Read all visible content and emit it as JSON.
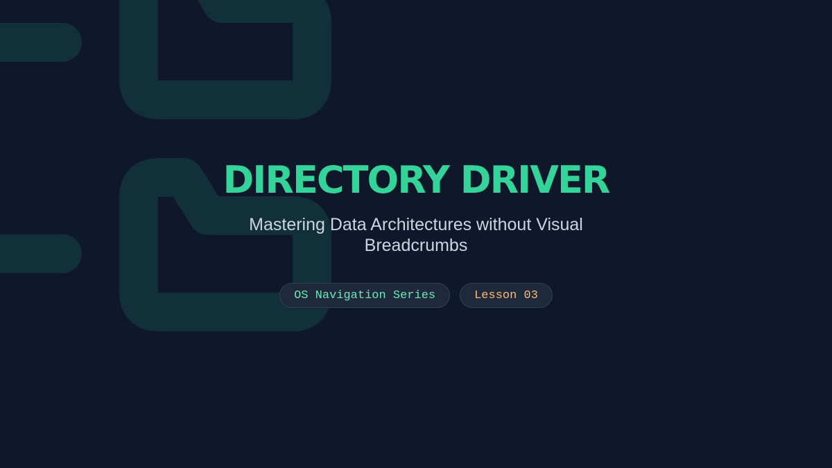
{
  "hero": {
    "title": "DIRECTORY DRIVER",
    "subtitle": "Mastering Data Architectures without Visual Breadcrumbs"
  },
  "tags": {
    "series": "OS Navigation Series",
    "lesson": "Lesson 03"
  },
  "background": {
    "icon": "folder-tree-icon"
  },
  "colors": {
    "background": "#0f172a",
    "accent": "#34d399",
    "subtitle_text": "#cbd5e1",
    "series_tag_text": "#6ee7b7",
    "lesson_tag_text": "#fdba74",
    "tag_background": "#1e293b",
    "decor_shape": "#12303a"
  }
}
